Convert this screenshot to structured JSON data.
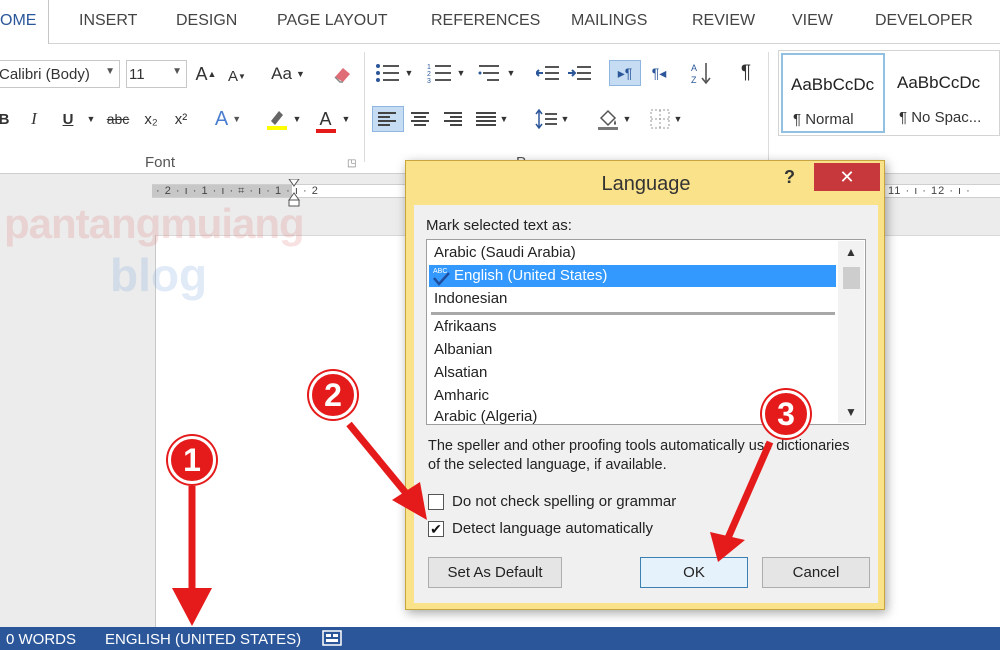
{
  "ribbon": {
    "tabs": [
      "OME",
      "INSERT",
      "DESIGN",
      "PAGE LAYOUT",
      "REFERENCES",
      "MAILINGS",
      "REVIEW",
      "VIEW",
      "DEVELOPER"
    ],
    "font_name": "Calibri (Body)",
    "font_size": "11",
    "grow_font": "A",
    "shrink_font": "A",
    "change_case": "Aa",
    "bold": "B",
    "italic": "I",
    "underline": "U",
    "strikethrough": "abc",
    "subscript": "x₂",
    "superscript": "x²",
    "text_effects": "A",
    "font_color": "A",
    "font_group_label": "Font",
    "paragraph_group_label": "P",
    "styles": [
      {
        "sample": "AaBbCcDc",
        "name": "¶ Normal"
      },
      {
        "sample": "AaBbCcDc",
        "name": "¶ No Spac..."
      }
    ]
  },
  "ruler": {
    "left_text": "· 2 · ı · 1 · ı · ⌗ · ı · 1 · ı · 2",
    "right_text": "11 · ı · 12 · ı ·"
  },
  "watermark": {
    "line1": "pantangmuiang",
    "line2": "blog"
  },
  "status": {
    "words": "0 WORDS",
    "language": "ENGLISH (UNITED STATES)"
  },
  "dialog": {
    "title": "Language",
    "help": "?",
    "close": "✕",
    "mark_label": "Mark selected text as:",
    "languages": [
      "Arabic (Saudi Arabia)",
      "English (United States)",
      "Indonesian",
      "Afrikaans",
      "Albanian",
      "Alsatian",
      "Amharic",
      "Arabic (Algeria)"
    ],
    "selected_language": "English (United States)",
    "info": "The speller and other proofing tools automatically use dictionaries of the selected language, if available.",
    "no_check_label": "Do not check spelling or grammar",
    "no_check_checked": false,
    "detect_label": "Detect language automatically",
    "detect_checked": true,
    "set_default": "Set As Default",
    "ok": "OK",
    "cancel": "Cancel"
  },
  "annotations": [
    "1",
    "2",
    "3"
  ],
  "colors": {
    "accent": "#2b579a",
    "annotation": "#e51b1b",
    "dialog_frame": "#f9e28a",
    "selection": "#3399ff"
  }
}
